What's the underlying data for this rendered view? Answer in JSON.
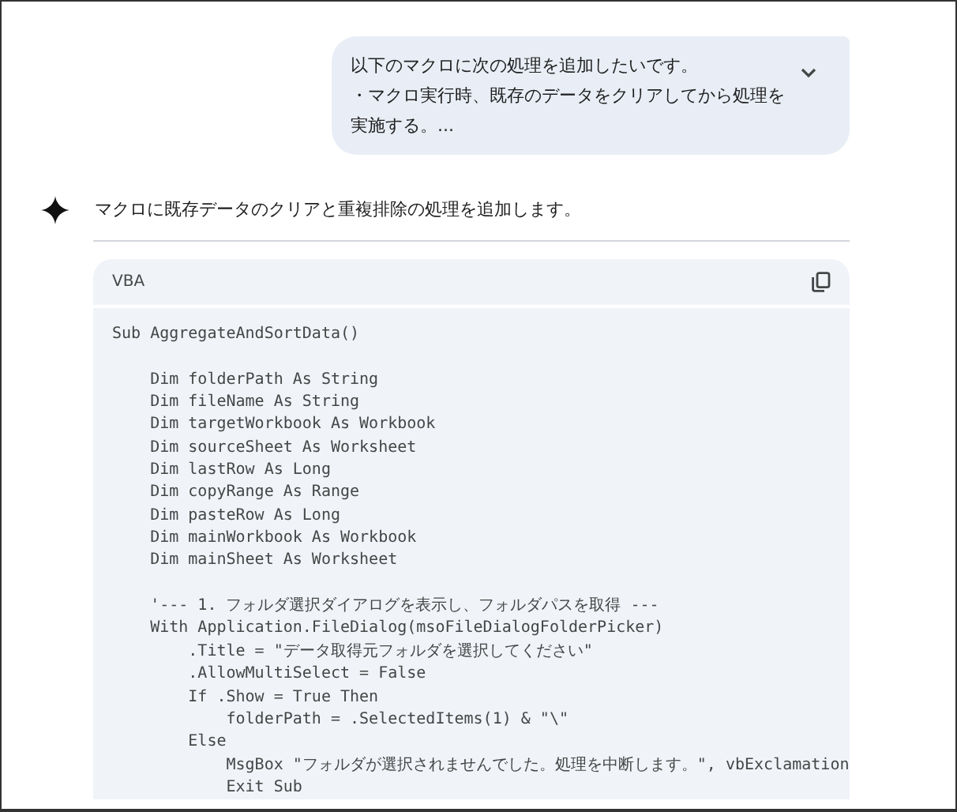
{
  "user_message": {
    "lines": [
      "以下のマクロに次の処理を追加したいです。",
      "・マクロ実行時、既存のデータをクリアしてから処理を",
      "実施する。..."
    ],
    "expanded": false
  },
  "response": {
    "text": "マクロに既存データのクリアと重複排除の処理を追加します。"
  },
  "code_block": {
    "language": "VBA",
    "code": "Sub AggregateAndSortData()\n\n    Dim folderPath As String\n    Dim fileName As String\n    Dim targetWorkbook As Workbook\n    Dim sourceSheet As Worksheet\n    Dim lastRow As Long\n    Dim copyRange As Range\n    Dim pasteRow As Long\n    Dim mainWorkbook As Workbook\n    Dim mainSheet As Worksheet\n\n    '--- 1. フォルダ選択ダイアログを表示し、フォルダパスを取得 ---\n    With Application.FileDialog(msoFileDialogFolderPicker)\n        .Title = \"データ取得元フォルダを選択してください\"\n        .AllowMultiSelect = False\n        If .Show = True Then\n            folderPath = .SelectedItems(1) & \"\\\"\n        Else\n            MsgBox \"フォルダが選択されませんでした。処理を中断します。\", vbExclamation\n            Exit Sub"
  }
}
